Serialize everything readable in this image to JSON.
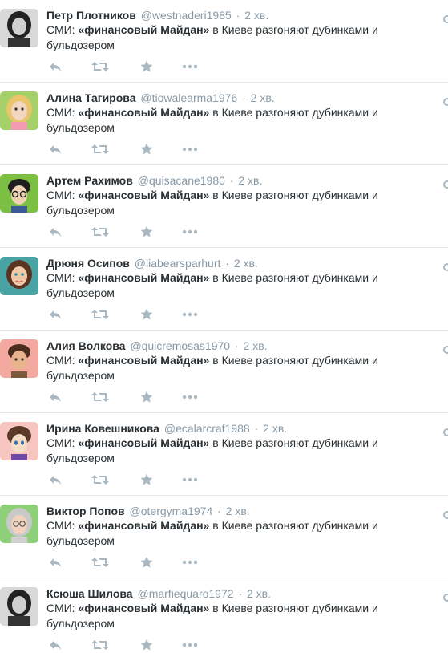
{
  "tweet_text": {
    "prefix": "СМИ: ",
    "bold": "«финансовый Майдан»",
    "suffix": " в Киеве разгоняют дубинками и бульдозером"
  },
  "separator": "·",
  "tweets": [
    {
      "fullname": "Петр Плотников",
      "username": "@westnaderi1985",
      "time": "2 хв.",
      "avatar_icon": "avatar-photo-bw-icon"
    },
    {
      "fullname": "Алина Тагирова",
      "username": "@tiowalearma1976",
      "time": "2 хв.",
      "avatar_icon": "avatar-cartoon-blonde-icon"
    },
    {
      "fullname": "Артем Рахимов",
      "username": "@quisacane1980",
      "time": "2 хв.",
      "avatar_icon": "avatar-cartoon-glasses-icon"
    },
    {
      "fullname": "Дрюня Осипов",
      "username": "@liabearsparhurt",
      "time": "2 хв.",
      "avatar_icon": "avatar-cartoon-brunette-icon"
    },
    {
      "fullname": "Алия Волкова",
      "username": "@quicremosas1970",
      "time": "2 хв.",
      "avatar_icon": "avatar-cartoon-boy-icon"
    },
    {
      "fullname": "Ирина Ковешникова",
      "username": "@ecalarcraf1988",
      "time": "2 хв.",
      "avatar_icon": "avatar-cartoon-anime-icon"
    },
    {
      "fullname": "Виктор Попов",
      "username": "@otergyma1974",
      "time": "2 хв.",
      "avatar_icon": "avatar-cartoon-grey-icon"
    },
    {
      "fullname": "Ксюша Шилова",
      "username": "@marfiequaro1972",
      "time": "2 хв.",
      "avatar_icon": "avatar-photo-bw-icon"
    }
  ],
  "colors": {
    "icon_grey": "#aab8c2",
    "meta_grey": "#8899a6",
    "text": "#292f33",
    "divider": "#e1e8ed"
  }
}
